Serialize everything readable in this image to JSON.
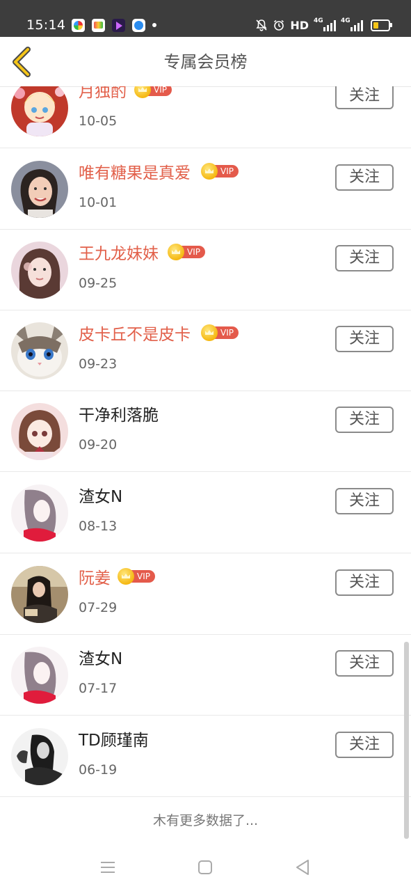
{
  "status_bar": {
    "time": "15:14",
    "hd_label": "HD",
    "signal1_label": "4G",
    "signal2_label": "4G"
  },
  "header": {
    "title": "专属会员榜",
    "back_icon": "chevron-left-icon"
  },
  "vip_label": "VIP",
  "follow_label": "关注",
  "members": [
    {
      "name": "月独酌",
      "date": "10-05",
      "vip": true
    },
    {
      "name": "唯有糖果是真爱",
      "date": "10-01",
      "vip": true
    },
    {
      "name": "王九龙妹妹",
      "date": "09-25",
      "vip": true
    },
    {
      "name": "皮卡丘不是皮卡",
      "date": "09-23",
      "vip": true
    },
    {
      "name": "干净利落脆",
      "date": "09-20",
      "vip": false
    },
    {
      "name": "渣女N",
      "date": "08-13",
      "vip": false
    },
    {
      "name": "阮姜",
      "date": "07-29",
      "vip": true
    },
    {
      "name": "渣女N",
      "date": "07-17",
      "vip": false
    },
    {
      "name": "TD顾瑾南",
      "date": "06-19",
      "vip": false
    }
  ],
  "footer_text": "木有更多数据了...",
  "colors": {
    "accent_yellow": "#f5c518",
    "vip_name": "#e2604a",
    "vip_tag": "#e45a4b",
    "status_bar": "#3d3d3d"
  }
}
